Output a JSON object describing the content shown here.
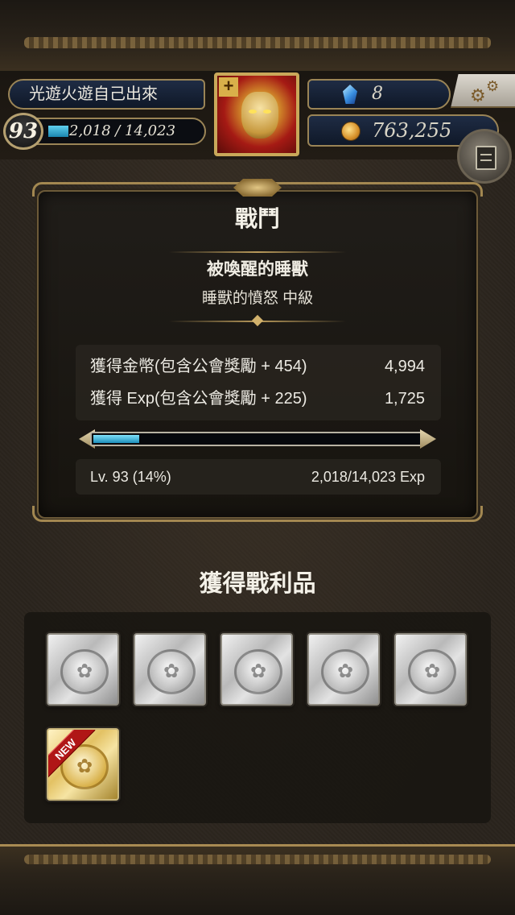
{
  "header": {
    "player_name": "光遊火遊自己出來",
    "level": "93",
    "exp_text": "2,018 / 14,023",
    "exp_progress": 0.14,
    "gems": "8",
    "coins": "763,255",
    "avatar_plus": "+"
  },
  "battle": {
    "title": "戰鬥",
    "quest_name": "被喚醒的睡獸",
    "quest_stage": "睡獸的憤怒 中級",
    "rewards": [
      {
        "label": "獲得金幣(包含公會獎勵 + 454)",
        "value": "4,994"
      },
      {
        "label": "獲得 Exp(包含公會獎勵 + 225)",
        "value": "1,725"
      }
    ],
    "level_text": "Lv. 93 (14%)",
    "exp_text": "2,018/14,023 Exp",
    "exp_progress": 0.14
  },
  "loot": {
    "title": "獲得戰利品",
    "items": [
      {
        "type": "silver"
      },
      {
        "type": "silver"
      },
      {
        "type": "silver"
      },
      {
        "type": "silver"
      },
      {
        "type": "silver"
      },
      {
        "type": "gold",
        "badge": "NEW"
      }
    ]
  },
  "icons": {
    "gem": "gem-icon",
    "coin": "coin-icon",
    "settings": "gear-icon",
    "menu": "document-icon"
  },
  "colors": {
    "accent_gold": "#b8995a",
    "exp_blue": "#1e8fbb",
    "new_red": "#b01616"
  }
}
